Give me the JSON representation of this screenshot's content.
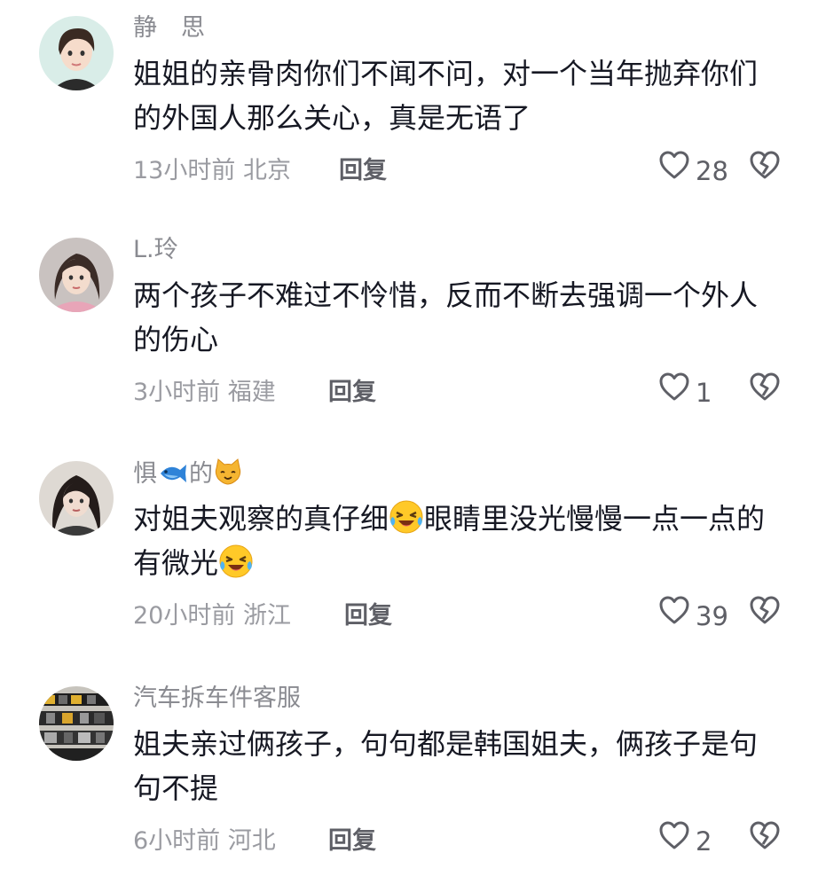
{
  "comments": [
    {
      "username": "静　思",
      "text": "姐姐的亲骨肉你们不闻不问，对一个当年抛弃你们的外国人那么关心，真是无语了",
      "time": "13小时前",
      "location": "北京",
      "reply_label": "回复",
      "likes": "28"
    },
    {
      "username": "L.玲",
      "text": "两个孩子不难过不怜惜，反而不断去强调一个外人的伤心",
      "time": "3小时前",
      "location": "福建",
      "reply_label": "回复",
      "likes": "1"
    },
    {
      "username_parts": [
        "惧",
        "的"
      ],
      "text_parts": [
        "对姐夫观察的真仔细",
        "眼睛里没光慢慢一点一点的有微光"
      ],
      "time": "20小时前",
      "location": "浙江",
      "reply_label": "回复",
      "likes": "39"
    },
    {
      "username": "汽车拆车件客服",
      "text": "姐夫亲过俩孩子，句句都是韩国姐夫，俩孩子是句句不提",
      "time": "6小时前",
      "location": "河北",
      "reply_label": "回复",
      "likes": "2"
    }
  ],
  "icons": {
    "like": "heart-outline-icon",
    "dislike": "broken-heart-outline-icon",
    "emoji": "laughing-crying-emoji-icon",
    "fish": "fish-icon",
    "cat": "cat-face-icon"
  },
  "colors": {
    "username": "#8a8b91",
    "text": "#161823",
    "meta": "#9a9ba1",
    "reply": "#5e5f66"
  }
}
